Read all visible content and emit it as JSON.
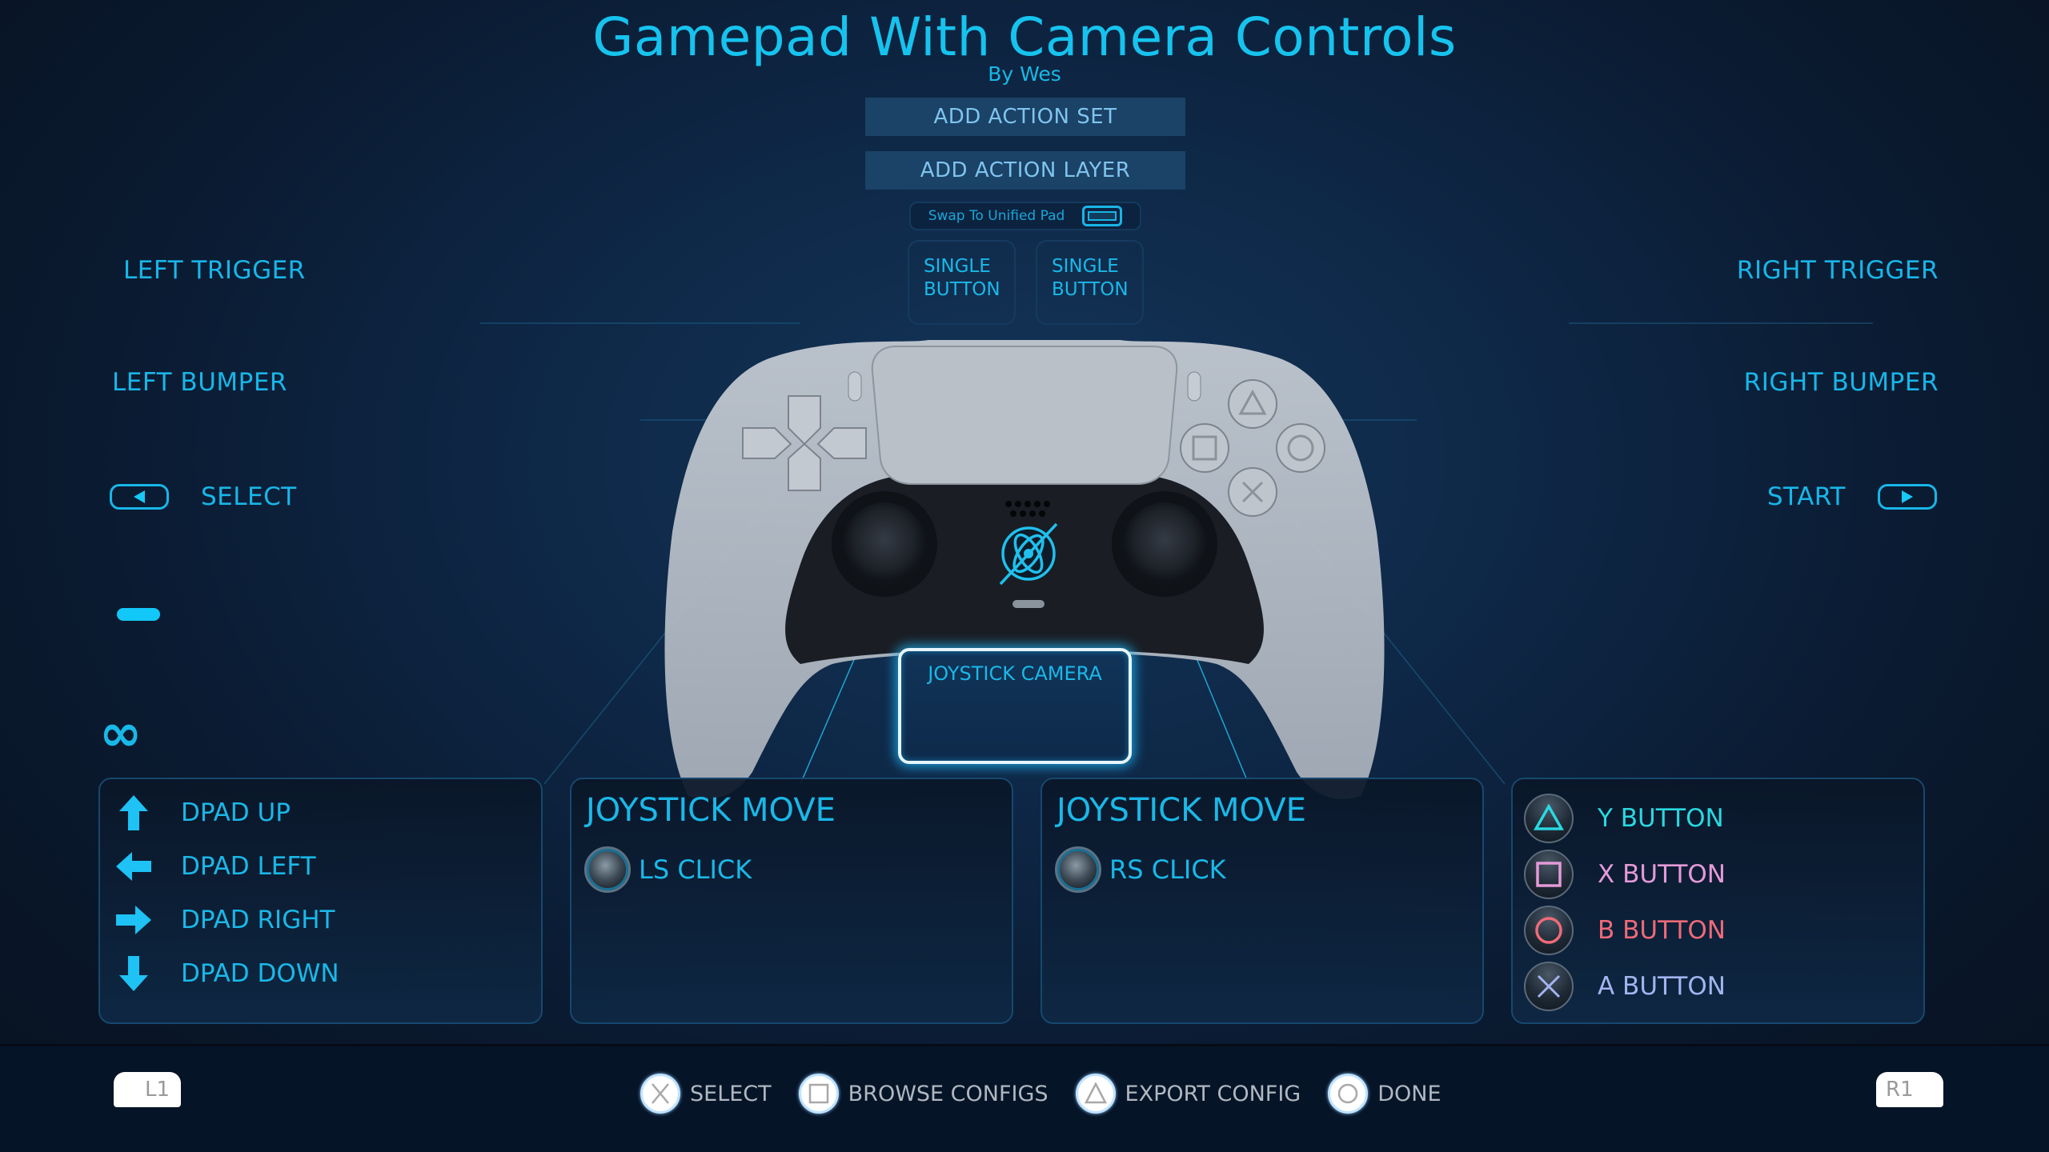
{
  "header": {
    "title": "Gamepad With Camera Controls",
    "byline": "By Wes",
    "add_action_set": "ADD ACTION SET",
    "add_action_layer": "ADD ACTION LAYER",
    "swap_label": "Swap To Unified Pad"
  },
  "top_bindings": {
    "left_touch": {
      "line1": "SINGLE",
      "line2": "BUTTON"
    },
    "right_touch": {
      "line1": "SINGLE",
      "line2": "BUTTON"
    }
  },
  "left_side": {
    "trigger": "LEFT TRIGGER",
    "bumper": "LEFT BUMPER",
    "select": "SELECT",
    "select_icon": "select-back-icon",
    "extra_icon_1": "touchpad-dash-icon",
    "extra_icon_2": "infinity-icon"
  },
  "right_side": {
    "trigger": "RIGHT TRIGGER",
    "bumper": "RIGHT BUMPER",
    "start": "START",
    "start_icon": "start-forward-icon"
  },
  "center": {
    "camera_label": "JOYSTICK CAMERA",
    "gyro_icon": "gyro-icon"
  },
  "panels": {
    "dpad": {
      "items": [
        {
          "icon": "arrow-up-icon",
          "label": "DPAD UP"
        },
        {
          "icon": "arrow-left-icon",
          "label": "DPAD LEFT"
        },
        {
          "icon": "arrow-right-icon",
          "label": "DPAD RIGHT"
        },
        {
          "icon": "arrow-down-icon",
          "label": "DPAD DOWN"
        }
      ]
    },
    "left_stick": {
      "title": "JOYSTICK MOVE",
      "click": "LS CLICK"
    },
    "right_stick": {
      "title": "JOYSTICK MOVE",
      "click": "RS CLICK"
    },
    "face": {
      "items": [
        {
          "icon": "triangle-icon",
          "label": "Y BUTTON",
          "color": "#2ad8e0"
        },
        {
          "icon": "square-icon",
          "label": "X BUTTON",
          "color": "#e49ad8"
        },
        {
          "icon": "circle-icon",
          "label": "B BUTTON",
          "color": "#ef6a78"
        },
        {
          "icon": "cross-icon",
          "label": "A BUTTON",
          "color": "#a4b4f0"
        }
      ]
    }
  },
  "footer": {
    "l1": "L1",
    "r1": "R1",
    "actions": [
      {
        "icon": "cross-icon",
        "label": "SELECT"
      },
      {
        "icon": "square-icon",
        "label": "BROWSE CONFIGS"
      },
      {
        "icon": "triangle-icon",
        "label": "EXPORT CONFIG"
      },
      {
        "icon": "circle-icon",
        "label": "DONE"
      }
    ]
  },
  "colors": {
    "accent": "#1cbdee",
    "panel_border": "#17486d",
    "button_bg": "#1b4267"
  }
}
